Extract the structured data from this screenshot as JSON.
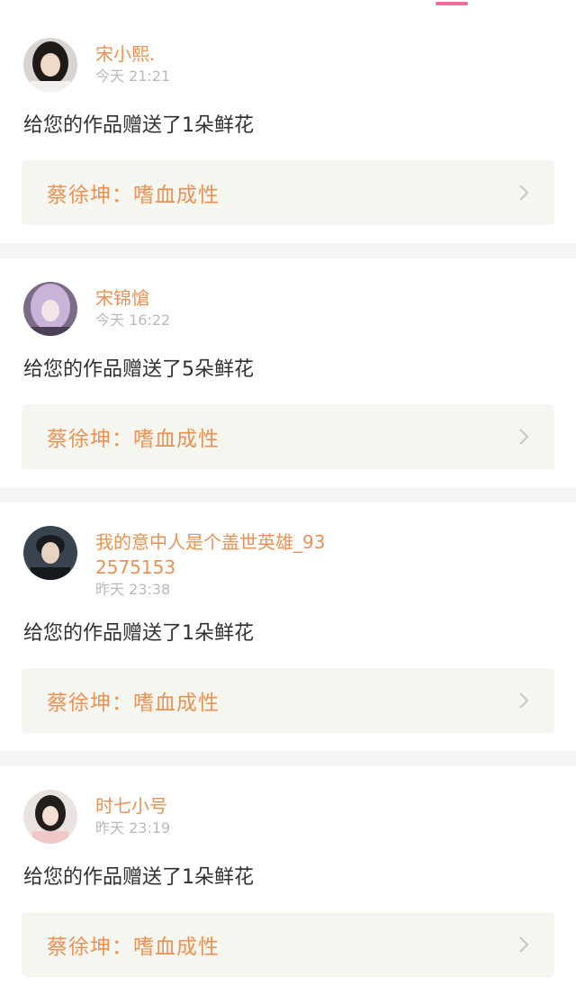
{
  "colors": {
    "accent_orange": "#ea9255",
    "tab_pink": "#f06a9b",
    "link_bg": "#f6f6f1",
    "separator": "#f5f5f5"
  },
  "feed": [
    {
      "username": "宋小熙.",
      "time": "今天 21:21",
      "message": "给您的作品赠送了1朵鲜花",
      "work_title": "蔡徐坤：嗜血成性",
      "avatar_icon": "avatar-girl-photo"
    },
    {
      "username": "宋锦愴",
      "time": "今天 16:22",
      "message": "给您的作品赠送了5朵鲜花",
      "work_title": "蔡徐坤：嗜血成性",
      "avatar_icon": "avatar-purple-hair-photo"
    },
    {
      "username": "我的意中人是个盖世英雄_932575153",
      "time": "昨天 23:38",
      "message": "给您的作品赠送了1朵鲜花",
      "work_title": "蔡徐坤：嗜血成性",
      "avatar_icon": "avatar-boy-photo"
    },
    {
      "username": "时七小号",
      "time": "昨天 23:19",
      "message": "给您的作品赠送了1朵鲜花",
      "work_title": "蔡徐坤：嗜血成性",
      "avatar_icon": "avatar-girl-dark-hair-photo"
    }
  ]
}
